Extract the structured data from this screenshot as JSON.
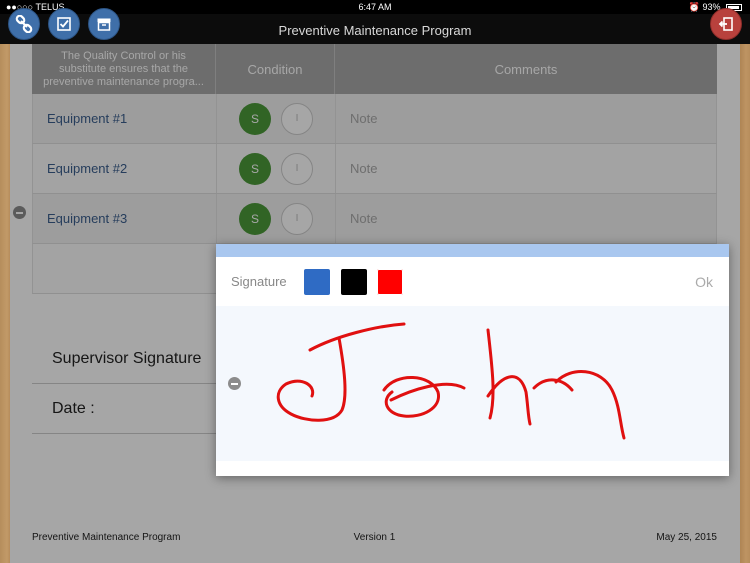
{
  "status_bar": {
    "carrier": "●●○○○ TELUS",
    "time": "6:47 AM",
    "battery": "93%"
  },
  "nav": {
    "title": "Preventive Maintenance Program",
    "buttons": [
      "link-icon",
      "checklist-icon",
      "archive-icon",
      "exit-icon"
    ]
  },
  "table": {
    "headers": {
      "col1": "The Quality Control or his substitute ensures that the preventive maintenance progra...",
      "col2": "Condition",
      "col3": "Comments"
    },
    "rows": [
      {
        "label": "Equipment #1",
        "s": "S",
        "i": "I",
        "note": "Note"
      },
      {
        "label": "Equipment #2",
        "s": "S",
        "i": "I",
        "note": "Note"
      },
      {
        "label": "Equipment #3",
        "s": "S",
        "i": "I",
        "note": "Note"
      }
    ]
  },
  "signature_section": {
    "supervisor": "Supervisor Signature",
    "date": "Date :"
  },
  "footer": {
    "left": "Preventive Maintenance Program",
    "center": "Version 1",
    "right": "May 25, 2015"
  },
  "modal": {
    "label": "Signature",
    "ok": "Ok",
    "colors": [
      "#2f6bc4",
      "#000000",
      "#ff0000"
    ],
    "ink_color": "#e01010",
    "signature_text": "John"
  }
}
